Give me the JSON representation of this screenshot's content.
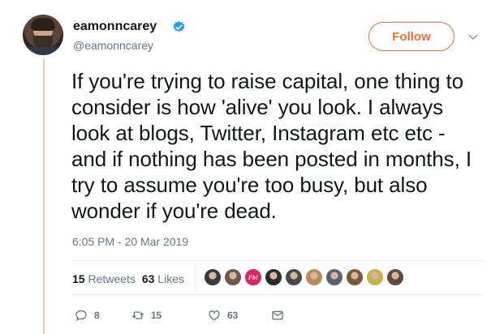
{
  "author": {
    "display_name": "eamonncarey",
    "handle": "@eamonncarey",
    "verified": true
  },
  "follow_label": "Follow",
  "tweet": {
    "text": "If you're trying to raise capital, one thing to consider is how 'alive' you look. I always look at blogs, Twitter, Instagram etc etc - and if nothing has been posted in months, I try to assume you're too busy, but also wonder if you're dead.",
    "timestamp": "6:05 PM - 20 Mar 2019"
  },
  "stats": {
    "retweets_count": "15",
    "retweets_label": "Retweets",
    "likes_count": "63",
    "likes_label": "Likes"
  },
  "likers": [
    {
      "color": "#3a3a3a"
    },
    {
      "color": "#6b5a4a"
    },
    {
      "color": "#e0245e",
      "logo": "Fb!"
    },
    {
      "color": "#2b2b2b"
    },
    {
      "color": "#4a4a4a"
    },
    {
      "color": "#b88a5a"
    },
    {
      "color": "#5a6270"
    },
    {
      "color": "#7a5a3a"
    },
    {
      "color": "#c9b24a"
    },
    {
      "color": "#5e4a3e"
    }
  ],
  "actions": {
    "replies": "8",
    "retweets": "15",
    "likes": "63"
  },
  "colors": {
    "accent": "#e8703a",
    "verified": "#1da1f2",
    "muted": "#657786",
    "thread": "#f5c8a8"
  }
}
